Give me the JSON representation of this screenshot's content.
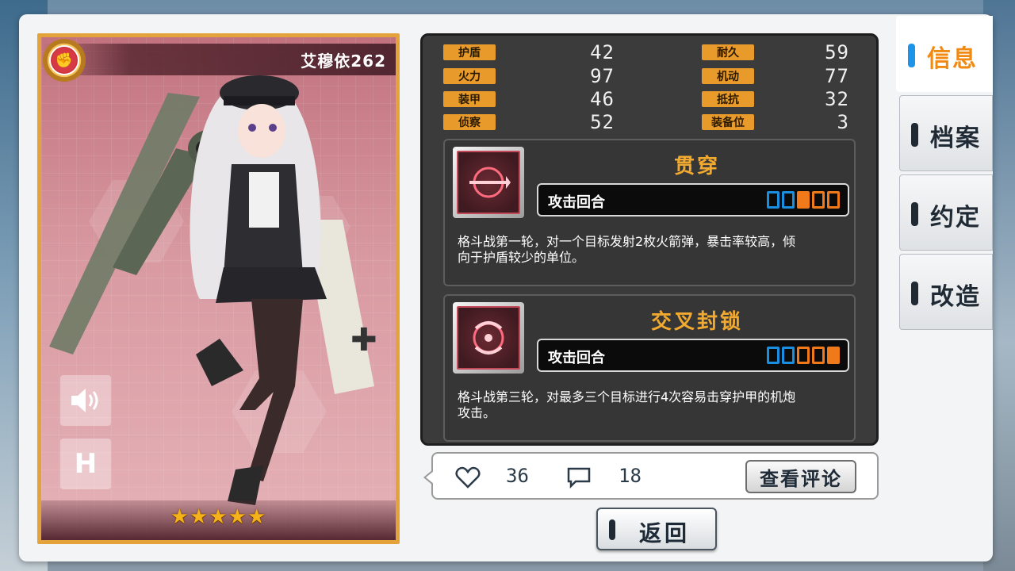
{
  "card": {
    "name": "艾穆依262",
    "rarity_stars": "★★★★★",
    "role_icon": "fist-icon",
    "sound_icon": "speaker-icon",
    "h_button_label": "H"
  },
  "stats": [
    {
      "label": "护盾",
      "value": "42"
    },
    {
      "label": "耐久",
      "value": "59"
    },
    {
      "label": "火力",
      "value": "97"
    },
    {
      "label": "机动",
      "value": "77"
    },
    {
      "label": "装甲",
      "value": "46"
    },
    {
      "label": "抵抗",
      "value": "32"
    },
    {
      "label": "侦察",
      "value": "52"
    },
    {
      "label": "装备位",
      "value": "3"
    }
  ],
  "skills": [
    {
      "name": "贯穿",
      "turn_label": "攻击回合",
      "turn_boxes": [
        "off",
        "off",
        "on",
        "off-o",
        "off-o"
      ],
      "description": "格斗战第一轮，对一个目标发射2枚火箭弹，暴击率较高，倾向于护盾较少的单位。"
    },
    {
      "name": "交叉封锁",
      "turn_label": "攻击回合",
      "turn_boxes": [
        "off",
        "off",
        "off-o",
        "off-o",
        "on"
      ],
      "description": "格斗战第三轮，对最多三个目标进行4次容易击穿护甲的机炮攻击。"
    }
  ],
  "social": {
    "likes": "36",
    "comments": "18",
    "review_button": "查看评论"
  },
  "back_button": "返回",
  "tabs": [
    {
      "label": "信息",
      "active": true
    },
    {
      "label": "档案",
      "active": false
    },
    {
      "label": "约定",
      "active": false
    },
    {
      "label": "改造",
      "active": false
    }
  ],
  "colors": {
    "accent_orange": "#f08a12",
    "card_border": "#e3a33a",
    "stat_label_bg": "#e89a2a",
    "active_tab_mark": "#1e94e8"
  }
}
